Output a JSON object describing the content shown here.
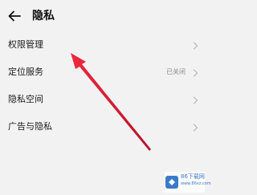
{
  "header": {
    "title": "隐私",
    "back_icon": "arrow-left-icon"
  },
  "menu": {
    "items": [
      {
        "label": "权限管理",
        "value": "",
        "chevron_icon": "chevron-right-icon"
      },
      {
        "label": "定位服务",
        "value": "已关闭",
        "chevron_icon": "chevron-right-icon"
      },
      {
        "label": "隐私空间",
        "value": "",
        "chevron_icon": "chevron-right-icon"
      },
      {
        "label": "广告与隐私",
        "value": "",
        "chevron_icon": "chevron-right-icon"
      }
    ]
  },
  "annotation": {
    "arrow_color": "#e0243a",
    "icon": "red-pointer-arrow-icon"
  },
  "watermark": {
    "title": "86下载网",
    "subtitle": "www.86xz.com",
    "icon": "site-logo-icon"
  },
  "colors": {
    "background": "#f2f2f2",
    "text_primary": "#1a1a1a",
    "text_secondary": "#8a8a8a",
    "watermark_blue": "#3b7ac8"
  }
}
